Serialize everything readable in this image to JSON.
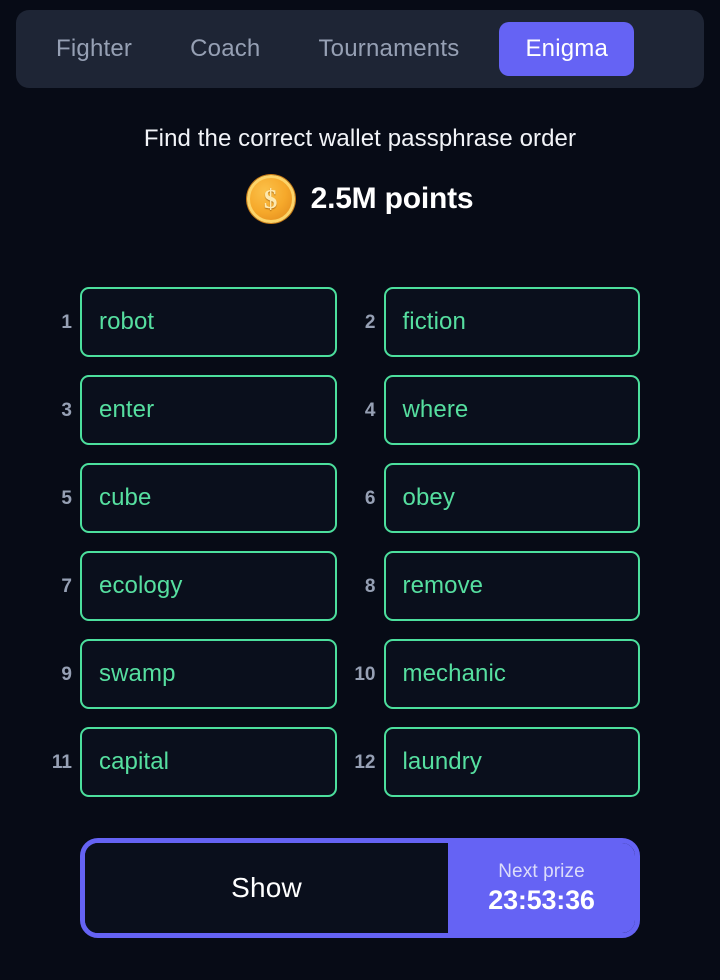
{
  "colors": {
    "page_bg": "#070b16",
    "tabbar_bg": "#1e2535",
    "accent_purple": "#6563f4",
    "accent_green": "#4cdf9d",
    "word_text": "#56dfa0",
    "muted_text": "#96a0b4",
    "coin_gold": "#f6a92b"
  },
  "tabs": [
    {
      "label": "Fighter",
      "active": false
    },
    {
      "label": "Coach",
      "active": false
    },
    {
      "label": "Tournaments",
      "active": false
    },
    {
      "label": "Enigma",
      "active": true
    }
  ],
  "prompt": "Find the correct wallet passphrase order",
  "reward": {
    "coin_icon": "gold-coin-dollar-icon",
    "coin_glyph": "$",
    "amount": "2.5M points"
  },
  "words": [
    {
      "index": "1",
      "word": "robot"
    },
    {
      "index": "2",
      "word": "fiction"
    },
    {
      "index": "3",
      "word": "enter"
    },
    {
      "index": "4",
      "word": "where"
    },
    {
      "index": "5",
      "word": "cube"
    },
    {
      "index": "6",
      "word": "obey"
    },
    {
      "index": "7",
      "word": "ecology"
    },
    {
      "index": "8",
      "word": "remove"
    },
    {
      "index": "9",
      "word": "swamp"
    },
    {
      "index": "10",
      "word": "mechanic"
    },
    {
      "index": "11",
      "word": "capital"
    },
    {
      "index": "12",
      "word": "laundry"
    }
  ],
  "footer": {
    "show_label": "Show",
    "prize_label": "Next prize",
    "prize_timer": "23:53:36"
  }
}
